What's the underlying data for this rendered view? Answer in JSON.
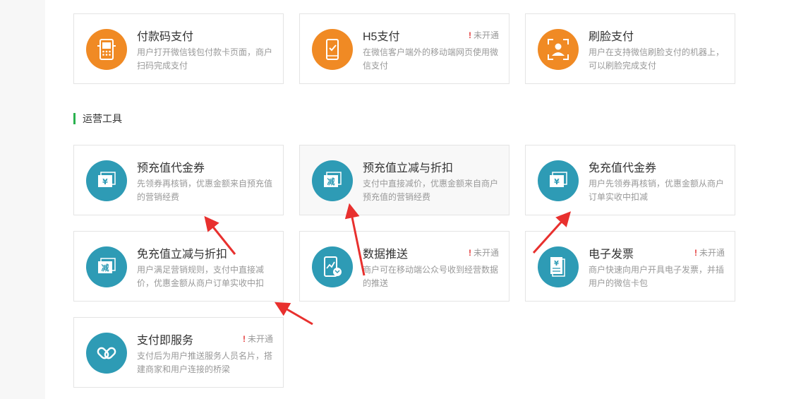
{
  "payment": {
    "card1": {
      "title": "付款码支付",
      "desc": "用户打开微信钱包付款卡页面，商户扫码完成支付"
    },
    "card2": {
      "title": "H5支付",
      "desc": "在微信客户端外的移动端网页使用微信支付",
      "status": "未开通"
    },
    "card3": {
      "title": "刷脸支付",
      "desc": "用户在支持微信刷脸支付的机器上，可以刷脸完成支付"
    }
  },
  "operations": {
    "section_title": "运营工具",
    "card1": {
      "title": "预充值代金券",
      "desc": "先领券再核销，优惠金额来自预充值的营销经费"
    },
    "card2": {
      "title": "预充值立减与折扣",
      "desc": "支付中直接减价，优惠金额来自商户预充值的营销经费"
    },
    "card3": {
      "title": "免充值代金券",
      "desc": "用户先领券再核销，优惠金额从商户订单实收中扣减"
    },
    "card4": {
      "title": "免充值立减与折扣",
      "desc": "用户满足营销规则，支付中直接减价，优惠金额从商户订单实收中扣"
    },
    "card5": {
      "title": "数据推送",
      "desc": "商户可在移动端公众号收到经营数据的推送",
      "status": "未开通"
    },
    "card6": {
      "title": "电子发票",
      "desc": "商户快速向用户开具电子发票，并插用户的微信卡包",
      "status": "未开通"
    },
    "card7": {
      "title": "支付即服务",
      "desc": "支付后为用户推送服务人员名片，搭建商家和用户连接的桥梁",
      "status": "未开通"
    }
  },
  "icon_labels": {
    "yen": "¥",
    "jian": "减"
  },
  "colors": {
    "orange": "#f08a24",
    "teal": "#2e9bb5",
    "arrow_red": "#e8302e",
    "accent_green": "#2ab24f"
  }
}
